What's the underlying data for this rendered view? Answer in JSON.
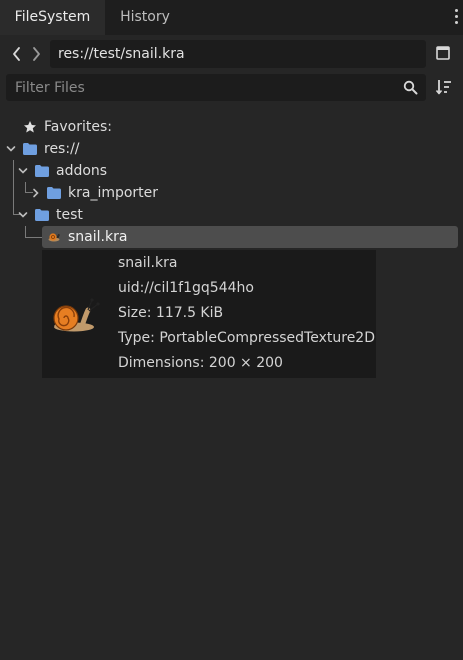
{
  "tabs": [
    {
      "label": "FileSystem",
      "active": true
    },
    {
      "label": "History",
      "active": false
    }
  ],
  "path": {
    "value": "res://test/snail.kra"
  },
  "filter": {
    "placeholder": "Filter Files",
    "value": ""
  },
  "tree": {
    "favorites": "Favorites:",
    "root": "res://",
    "addons": "addons",
    "kra_importer": "kra_importer",
    "test": "test",
    "file": "snail.kra"
  },
  "tooltip": {
    "name": "snail.kra",
    "uid": "uid://cil1f1gq544ho",
    "size": "Size: 117.5 KiB",
    "type": "Type: PortableCompressedTexture2D",
    "dimensions": "Dimensions: 200 × 200"
  },
  "colors": {
    "folder": "#6f9fe0",
    "accent_text": "#dcdcdc",
    "selection": "#4d4d4d",
    "snail_shell": "#e07a1f"
  }
}
